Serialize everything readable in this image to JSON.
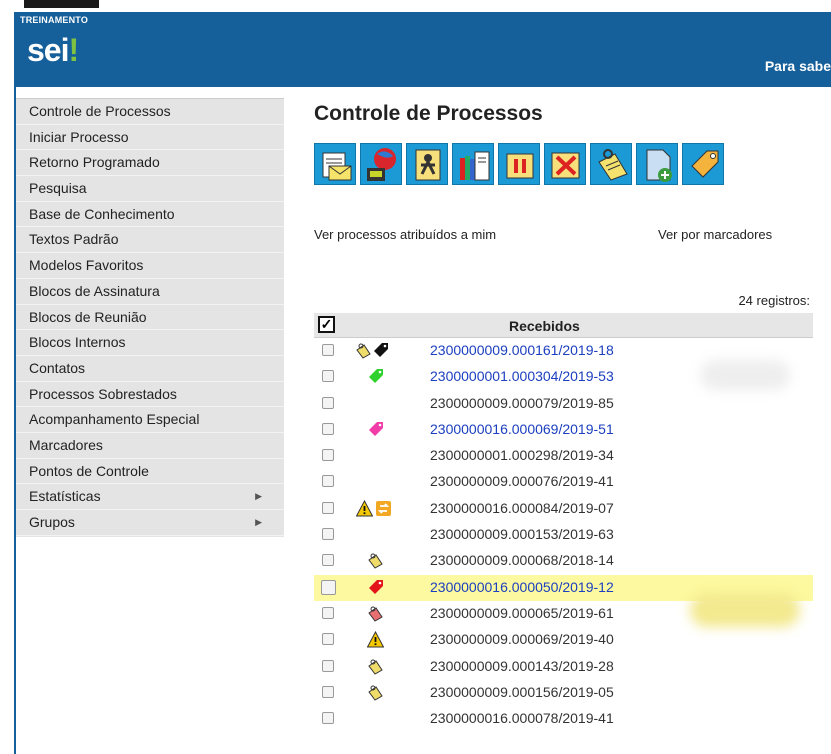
{
  "header": {
    "env_label": "TREINAMENTO",
    "logo_main": "sei",
    "logo_accent": "!",
    "right_text": "Para sabe"
  },
  "sidebar": {
    "items": [
      {
        "label": "Controle de Processos"
      },
      {
        "label": "Iniciar Processo"
      },
      {
        "label": "Retorno Programado"
      },
      {
        "label": "Pesquisa"
      },
      {
        "label": "Base de Conhecimento"
      },
      {
        "label": "Textos Padrão"
      },
      {
        "label": "Modelos Favoritos"
      },
      {
        "label": "Blocos de Assinatura"
      },
      {
        "label": "Blocos de Reunião"
      },
      {
        "label": "Blocos Internos"
      },
      {
        "label": "Contatos"
      },
      {
        "label": "Processos Sobrestados"
      },
      {
        "label": "Acompanhamento Especial"
      },
      {
        "label": "Marcadores"
      },
      {
        "label": "Pontos de Controle"
      },
      {
        "label": "Estatísticas",
        "submenu_arrow": "▶"
      },
      {
        "label": "Grupos",
        "submenu_arrow": "▶"
      }
    ]
  },
  "main": {
    "title": "Controle de Processos",
    "toolbar_icons": [
      "send-process-icon",
      "publish-icon",
      "assign-user-icon",
      "library-icon",
      "pause-icon",
      "conclude-process-icon",
      "annotation-icon",
      "new-document-icon",
      "marker-tag-icon"
    ],
    "link_assigned": "Ver processos atribuídos a mim",
    "link_markers": "Ver por marcadores",
    "records_count": "24 registros:",
    "table": {
      "header_check": "✓",
      "column_label": "Recebidos",
      "rows": [
        {
          "number": "2300000009.000161/2019-18",
          "link": true,
          "icons": [
            "annotation-note-icon",
            "black-tag-icon"
          ]
        },
        {
          "number": "2300000001.000304/2019-53",
          "link": true,
          "icons": [
            "green-tag-icon"
          ]
        },
        {
          "number": "2300000009.000079/2019-85",
          "link": false,
          "icons": []
        },
        {
          "number": "2300000016.000069/2019-51",
          "link": true,
          "icons": [
            "pink-tag-icon"
          ]
        },
        {
          "number": "2300000001.000298/2019-34",
          "link": false,
          "icons": []
        },
        {
          "number": "2300000009.000076/2019-41",
          "link": false,
          "icons": []
        },
        {
          "number": "2300000016.000084/2019-07",
          "link": false,
          "icons": [
            "warning-icon",
            "return-icon"
          ]
        },
        {
          "number": "2300000009.000153/2019-63",
          "link": false,
          "icons": []
        },
        {
          "number": "2300000009.000068/2018-14",
          "link": false,
          "icons": [
            "annotation-note-icon"
          ]
        },
        {
          "number": "2300000016.000050/2019-12",
          "link": true,
          "icons": [
            "red-tag-icon"
          ],
          "highlighted": true
        },
        {
          "number": "2300000009.000065/2019-61",
          "link": false,
          "icons": [
            "priority-note-icon"
          ]
        },
        {
          "number": "2300000009.000069/2019-40",
          "link": false,
          "icons": [
            "warning-icon"
          ]
        },
        {
          "number": "2300000009.000143/2019-28",
          "link": false,
          "icons": [
            "annotation-note-icon"
          ]
        },
        {
          "number": "2300000009.000156/2019-05",
          "link": false,
          "icons": [
            "annotation-note-icon"
          ]
        },
        {
          "number": "2300000016.000078/2019-41",
          "link": false,
          "icons": []
        }
      ]
    }
  },
  "colors": {
    "header_blue": "#155f9a",
    "link_blue": "#1b3fbf",
    "highlight_yellow": "#fdf9a0",
    "toolbar_blue": "#1b9ad6"
  }
}
